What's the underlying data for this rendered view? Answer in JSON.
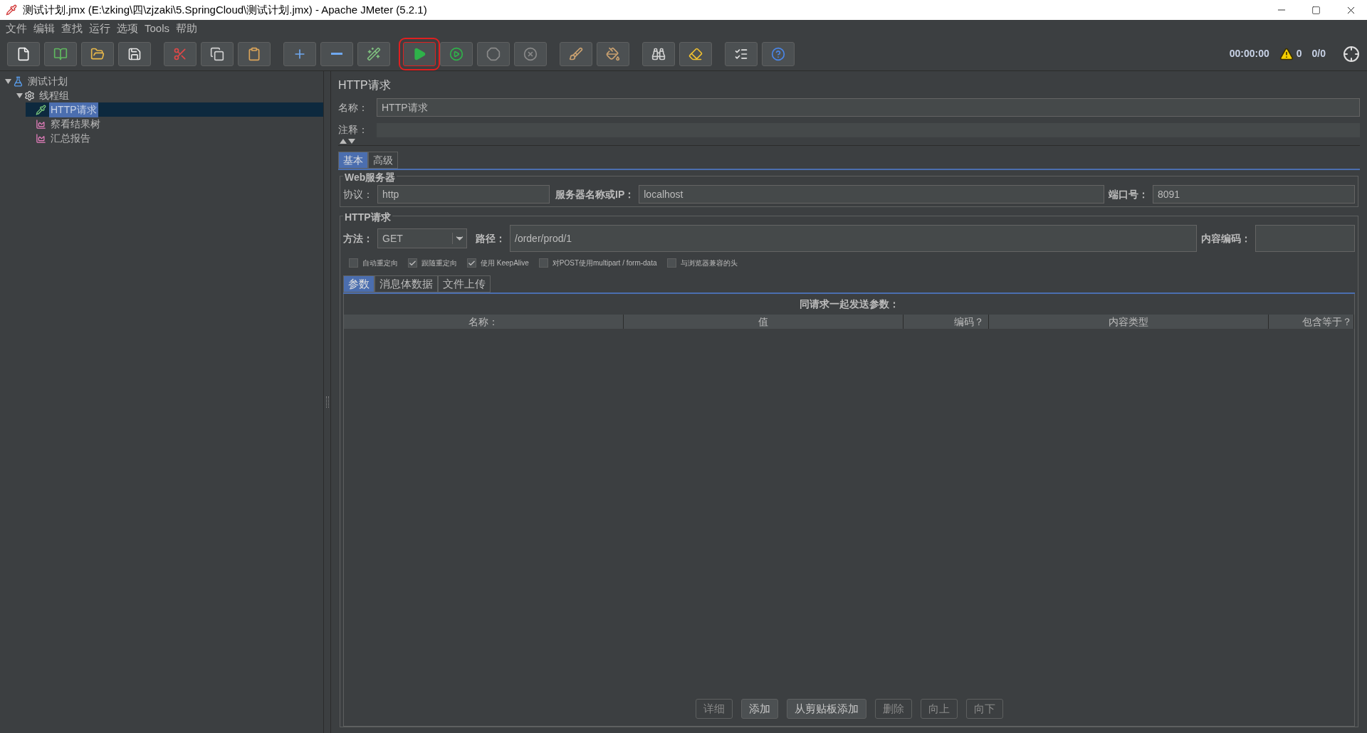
{
  "window": {
    "title": "测试计划.jmx (E:\\zking\\四\\zjzaki\\5.SpringCloud\\测试计划.jmx) - Apache JMeter (5.2.1)"
  },
  "menu": [
    "文件",
    "编辑",
    "查找",
    "运行",
    "选项",
    "Tools",
    "帮助"
  ],
  "toolbar": {
    "groups": [
      [
        {
          "kind": "new",
          "highlighted": false
        },
        {
          "kind": "templates",
          "highlighted": false
        },
        {
          "kind": "open",
          "highlighted": false
        },
        {
          "kind": "save",
          "highlighted": false
        }
      ],
      [
        {
          "kind": "cut",
          "highlighted": false
        },
        {
          "kind": "copy",
          "highlighted": false
        },
        {
          "kind": "paste",
          "highlighted": false
        }
      ],
      [
        {
          "kind": "expand",
          "highlighted": false
        },
        {
          "kind": "collapse",
          "highlighted": false
        },
        {
          "kind": "toggle",
          "highlighted": false
        }
      ],
      [
        {
          "kind": "start",
          "highlighted": true
        },
        {
          "kind": "start-no-timers",
          "highlighted": false
        },
        {
          "kind": "stop",
          "highlighted": false
        },
        {
          "kind": "shutdown",
          "highlighted": false
        }
      ],
      [
        {
          "kind": "clear",
          "highlighted": false
        },
        {
          "kind": "clear-all",
          "highlighted": false
        }
      ],
      [
        {
          "kind": "search",
          "highlighted": false
        },
        {
          "kind": "reset-search",
          "highlighted": false
        }
      ],
      [
        {
          "kind": "functions",
          "highlighted": false
        },
        {
          "kind": "help",
          "highlighted": false
        }
      ]
    ],
    "timer": "00:00:00",
    "warnings": "0",
    "threads": "0/0"
  },
  "tree": [
    {
      "label": "测试计划",
      "kind": "plan",
      "expanded": true,
      "selected": false,
      "children": [
        {
          "label": "线程组",
          "kind": "thread-group",
          "expanded": true,
          "selected": false,
          "children": [
            {
              "label": "HTTP请求",
              "kind": "sampler",
              "selected": true
            },
            {
              "label": "察看结果树",
              "kind": "listener",
              "selected": false
            },
            {
              "label": "汇总报告",
              "kind": "listener",
              "selected": false
            }
          ]
        }
      ]
    }
  ],
  "panel": {
    "title": "HTTP请求",
    "name_label": "名称：",
    "name_value": "HTTP请求",
    "comment_label": "注释：",
    "tabs": [
      {
        "label": "基本",
        "selected": true
      },
      {
        "label": "高级",
        "selected": false
      }
    ],
    "web_server": {
      "title": "Web服务器",
      "protocol_label": "协议：",
      "protocol": "http",
      "server_label": "服务器名称或IP：",
      "server": "localhost",
      "port_label": "端口号：",
      "port": "8091"
    },
    "http_request": {
      "title": "HTTP请求",
      "method_label": "方法：",
      "method": "GET",
      "path_label": "路径：",
      "path": "/order/prod/1",
      "encoding_label": "内容编码：",
      "options": [
        {
          "label": "自动重定向",
          "checked": false
        },
        {
          "label": "跟随重定向",
          "checked": true
        },
        {
          "label": "使用 KeepAlive",
          "checked": true
        },
        {
          "label": "对POST使用multipart / form-data",
          "checked": false
        },
        {
          "label": "与浏览器兼容的头",
          "checked": false
        }
      ]
    },
    "param_tabs": [
      {
        "label": "参数",
        "selected": true
      },
      {
        "label": "消息体数据",
        "selected": false
      },
      {
        "label": "文件上传",
        "selected": false
      }
    ],
    "params_caption": "同请求一起发送参数：",
    "columns": [
      "名称：",
      "值",
      "编码？",
      "内容类型",
      "包含等于？"
    ],
    "buttons": [
      {
        "label": "详细",
        "disabled": true
      },
      {
        "label": "添加",
        "disabled": false
      },
      {
        "label": "从剪贴板添加",
        "disabled": false
      },
      {
        "label": "删除",
        "disabled": true
      },
      {
        "label": "向上",
        "disabled": true
      },
      {
        "label": "向下",
        "disabled": true
      }
    ]
  }
}
